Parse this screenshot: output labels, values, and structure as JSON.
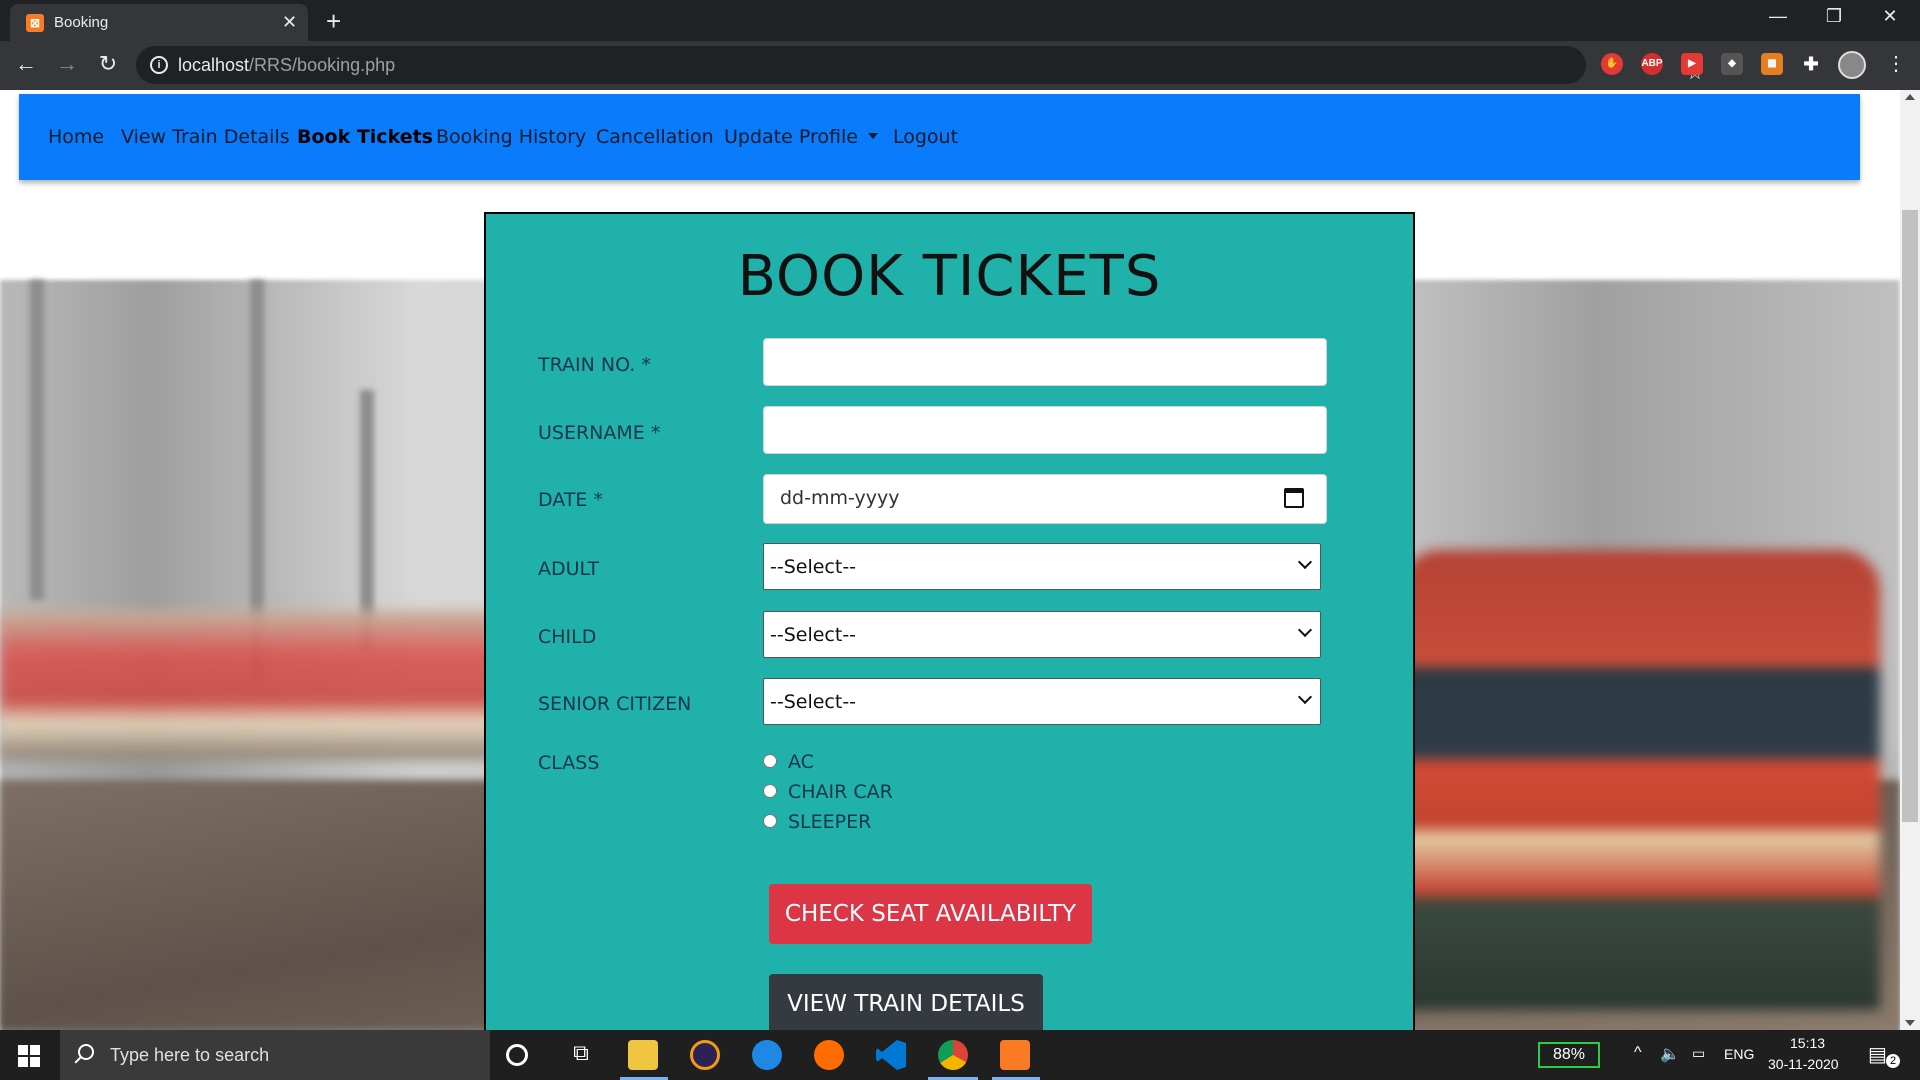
{
  "browser": {
    "tab_title": "Booking",
    "tab_favicon": "xampp-icon",
    "url_host": "localhost",
    "url_path": "/RRS/booking.php"
  },
  "nav": {
    "items": [
      {
        "label": "Home"
      },
      {
        "label": "View Train Details"
      },
      {
        "label": "Book Tickets",
        "active": true
      },
      {
        "label": "Booking History"
      },
      {
        "label": "Cancellation"
      },
      {
        "label": "Update Profile",
        "dropdown": true
      },
      {
        "label": "Logout"
      }
    ]
  },
  "form": {
    "title": "BOOK TICKETS",
    "train_no_label": "TRAIN NO. *",
    "train_no_value": "",
    "username_label": "USERNAME *",
    "username_value": "",
    "date_label": "DATE *",
    "date_placeholder": "dd-mm-yyyy",
    "adult_label": "ADULT",
    "adult_selected": "--Select--",
    "child_label": "CHILD",
    "child_selected": "--Select--",
    "senior_label": "SENIOR CITIZEN",
    "senior_selected": "--Select--",
    "class_label": "CLASS",
    "class_options": [
      "AC",
      "CHAIR CAR",
      "SLEEPER"
    ],
    "check_button": "CHECK SEAT AVAILABILTY",
    "view_button": "VIEW TRAIN DETAILS"
  },
  "taskbar": {
    "search_placeholder": "Type here to search",
    "battery": "88%",
    "language": "ENG",
    "time": "15:13",
    "date": "30-11-2020",
    "notifications": "2"
  },
  "colors": {
    "navbar": "#0a7bfb",
    "form_bg": "#20b2aa",
    "btn_danger": "#dc3545",
    "btn_dark": "#343a40"
  }
}
